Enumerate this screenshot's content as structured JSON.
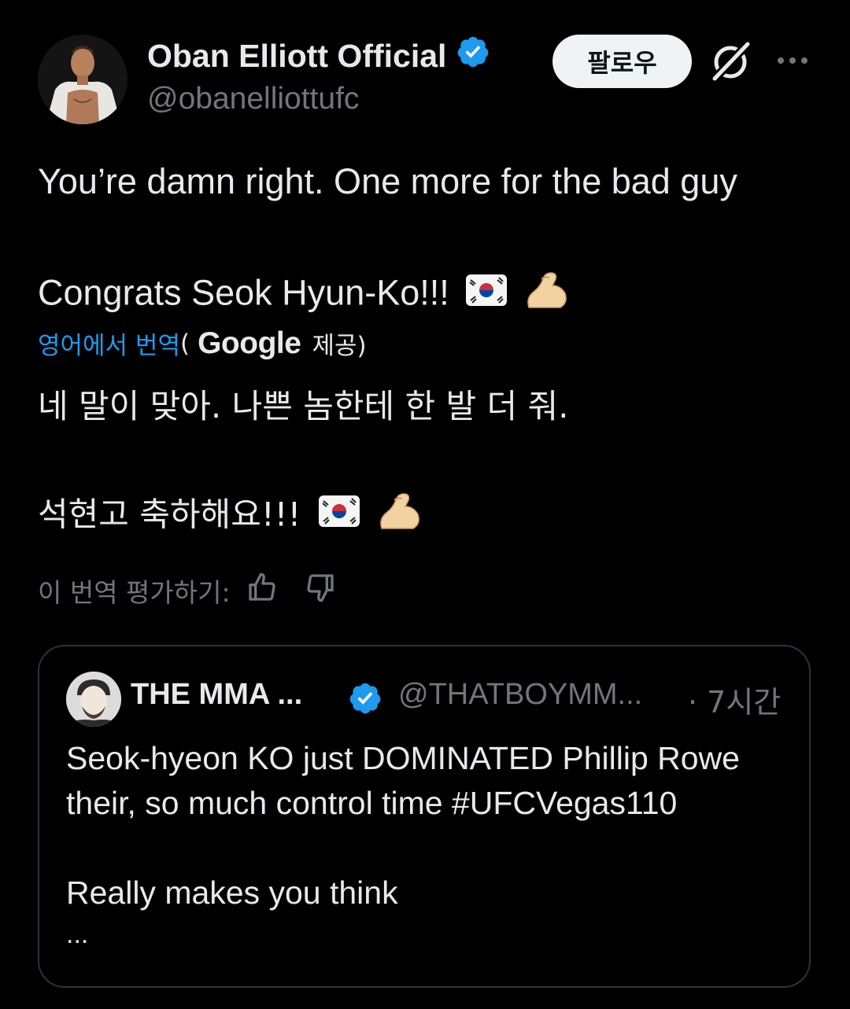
{
  "author": {
    "name": "Oban Elliott Official",
    "handle": "@obanelliottufc",
    "verified_color": "#1d9bf0"
  },
  "header": {
    "follow_label": "팔로우",
    "grok_icon": "grok-icon",
    "more_icon": "more-icon"
  },
  "tweet": {
    "line1": "You’re damn right. One more for the bad guy",
    "line2": "Congrats Seok Hyun-Ko!!!"
  },
  "translation": {
    "source_link": "영어에서 번역",
    "paren_open": "(",
    "provider": "Google",
    "provider_suffix": "제공)",
    "line1": "네 말이 맞아. 나쁜 놈한테 한 발 더 줘.",
    "line2": "석현고 축하해요!!!",
    "rate_label": "이 번역 평가하기:"
  },
  "quote": {
    "name": "THE MMA ...",
    "handle": "@THATBOYMM...",
    "time": "· 7시간",
    "line1": "Seok-hyeon KO just DOMINATED Phillip Rowe",
    "line2": "their, so much control time #UFCVegas110",
    "line3": "Really makes you think",
    "line4": "..."
  },
  "colors": {
    "background": "#000000",
    "text": "#e7e9ea",
    "muted": "#71767b",
    "link": "#1d9bf0",
    "border": "#2f3336"
  }
}
